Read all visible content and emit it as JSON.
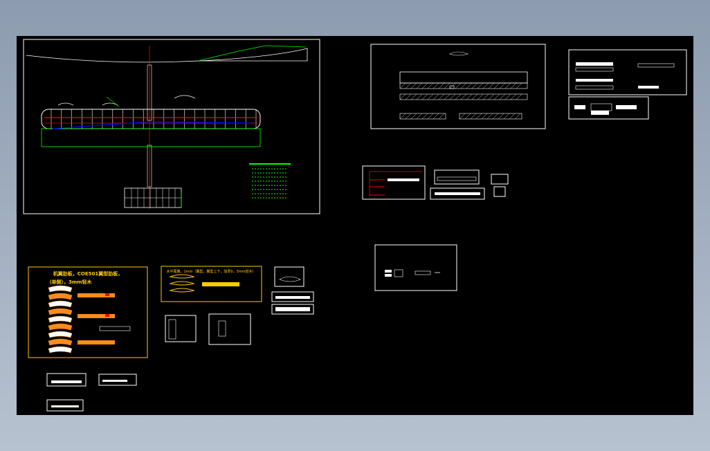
{
  "colors": {
    "background": "#000000",
    "frame": "#ffffff",
    "wing_outline": "#ffffff",
    "rib": "#ffffff",
    "spar": "#ff0000",
    "centerline": "#ff0000",
    "aileron": "#00ff00",
    "blue_member": "#0000ff",
    "title_text": "#ffcc00",
    "rib_fill": "#ff8c1a",
    "notes": "#00ff00"
  },
  "annotations": {
    "rib_sheet_title_line1": "机翼肋板，COE501翼型肋板，",
    "rib_sheet_title_line2": "（单侧），3mm轻木",
    "airfoil_sheet_title": "水平尾翼，1mm（翼型，翼型上下，加厚0，3mm轻木）"
  }
}
